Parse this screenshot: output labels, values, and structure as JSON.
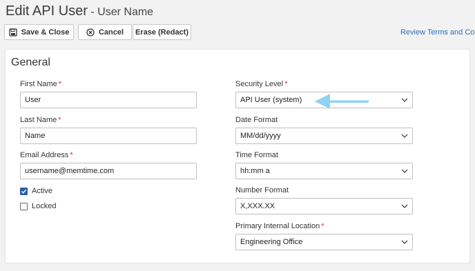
{
  "header": {
    "title": "Edit API User",
    "subtitle": "- User Name"
  },
  "toolbar": {
    "save_close_label": "Save & Close",
    "cancel_label": "Cancel",
    "erase_label": "Erase (Redact)",
    "review_terms_label": "Review Terms and Condit"
  },
  "form": {
    "section_title": "General",
    "first_name": {
      "label": "First Name",
      "value": "User"
    },
    "last_name": {
      "label": "Last Name",
      "value": "Name"
    },
    "email": {
      "label": "Email Address",
      "value": "username@memtime.com"
    },
    "active": {
      "label": "Active",
      "checked": true
    },
    "locked": {
      "label": "Locked",
      "checked": false
    },
    "security_level": {
      "label": "Security Level",
      "value": "API User (system)"
    },
    "date_format": {
      "label": "Date Format",
      "value": "MM/dd/yyyy"
    },
    "time_format": {
      "label": "Time Format",
      "value": "hh:mm a"
    },
    "number_format": {
      "label": "Number Format",
      "value": "X,XXX.XX"
    },
    "primary_location": {
      "label": "Primary Internal Location",
      "value": "Engineering Office"
    },
    "required_marker": "*"
  },
  "colors": {
    "accent": "#2c5fa8",
    "link": "#2a6ebb",
    "required": "#c9302c",
    "annotation_arrow": "#8fd3f4"
  }
}
